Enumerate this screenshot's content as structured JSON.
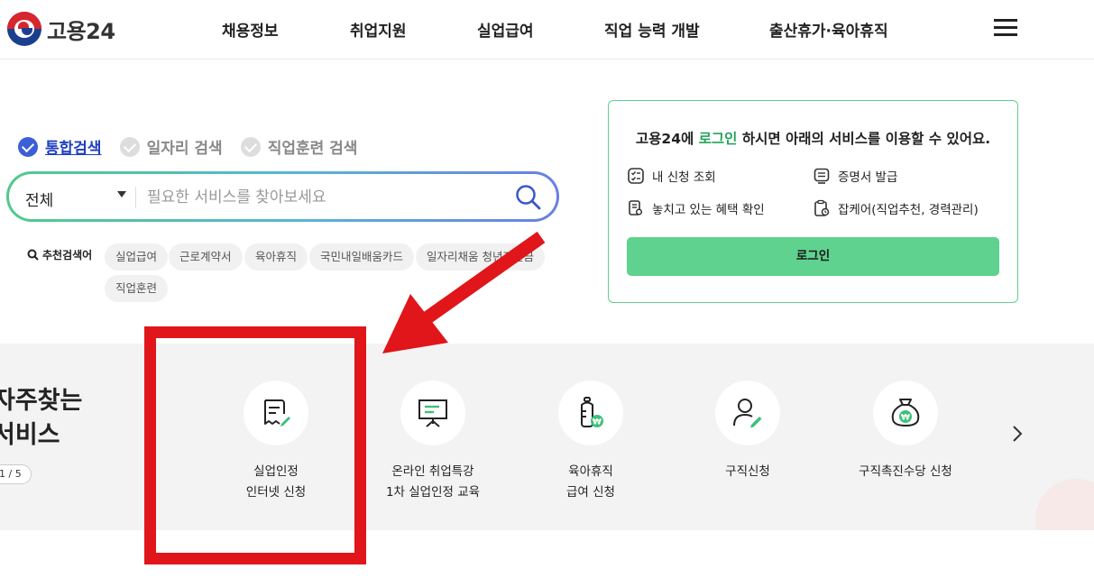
{
  "header": {
    "logo_text": "고용24",
    "nav": [
      "채용정보",
      "취업지원",
      "실업급여",
      "직업 능력 개발",
      "출산휴가·육아휴직"
    ]
  },
  "search": {
    "tabs": [
      {
        "label": "통합검색",
        "active": true
      },
      {
        "label": "일자리 검색",
        "active": false
      },
      {
        "label": "직업훈련 검색",
        "active": false
      }
    ],
    "category": "전체",
    "placeholder": "필요한 서비스를 찾아보세요"
  },
  "recommended": {
    "label": "추천검색어",
    "keywords": [
      "실업급여",
      "근로계약서",
      "육아휴직",
      "국민내일배움카드",
      "일자리채움 청년지원금",
      "직업훈련"
    ]
  },
  "login_box": {
    "message_prefix": "고용24에 ",
    "message_highlight": "로그인",
    "message_suffix": " 하시면 아래의 서비스를 이용할 수 있어요.",
    "items": [
      "내 신청 조회",
      "증명서 발급",
      "놓치고 있는 혜택 확인",
      "잡케어(직업추천, 경력관리)"
    ],
    "button_label": "로그인"
  },
  "services": {
    "title_line1": "자주찾는",
    "title_line2": "서비스",
    "pager": "1 / 5",
    "items": [
      {
        "line1": "실업인정",
        "line2": "인터넷 신청",
        "icon": "document-edit-icon"
      },
      {
        "line1": "온라인 취업특강",
        "line2": "1차 실업인정 교육",
        "icon": "presentation-board-icon"
      },
      {
        "line1": "육아휴직",
        "line2": "급여 신청",
        "icon": "baby-bottle-icon"
      },
      {
        "line1": "구직신청",
        "line2": "",
        "icon": "person-edit-icon"
      },
      {
        "line1": "구직촉진수당 신청",
        "line2": "",
        "icon": "money-bag-icon"
      }
    ]
  },
  "colors": {
    "brand_green": "#5ed28e",
    "active_blue": "#3d5fd6",
    "annotation_red": "#e0161a"
  }
}
